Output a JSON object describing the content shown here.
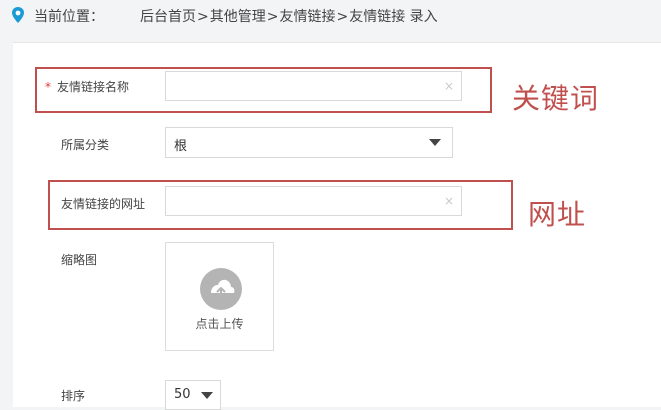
{
  "breadcrumb": {
    "prefix": "当前位置：",
    "items": [
      "后台首页",
      "其他管理",
      "友情链接",
      "友情链接 录入"
    ],
    "separator": ">"
  },
  "form": {
    "name": {
      "required_mark": "*",
      "label": "友情链接名称",
      "value": "",
      "clear": "×"
    },
    "category": {
      "label": "所属分类",
      "value": "根"
    },
    "url": {
      "label": "友情链接的网址",
      "value": "",
      "clear": "×"
    },
    "thumbnail": {
      "label": "缩略图",
      "upload_label": "点击上传"
    },
    "sort": {
      "label": "排序",
      "value": "50"
    }
  },
  "annotations": {
    "keyword": "关键词",
    "url": "网址"
  },
  "colors": {
    "annotation": "#c0504d",
    "required": "#e4393c",
    "location_icon": "#1a9ad6"
  }
}
